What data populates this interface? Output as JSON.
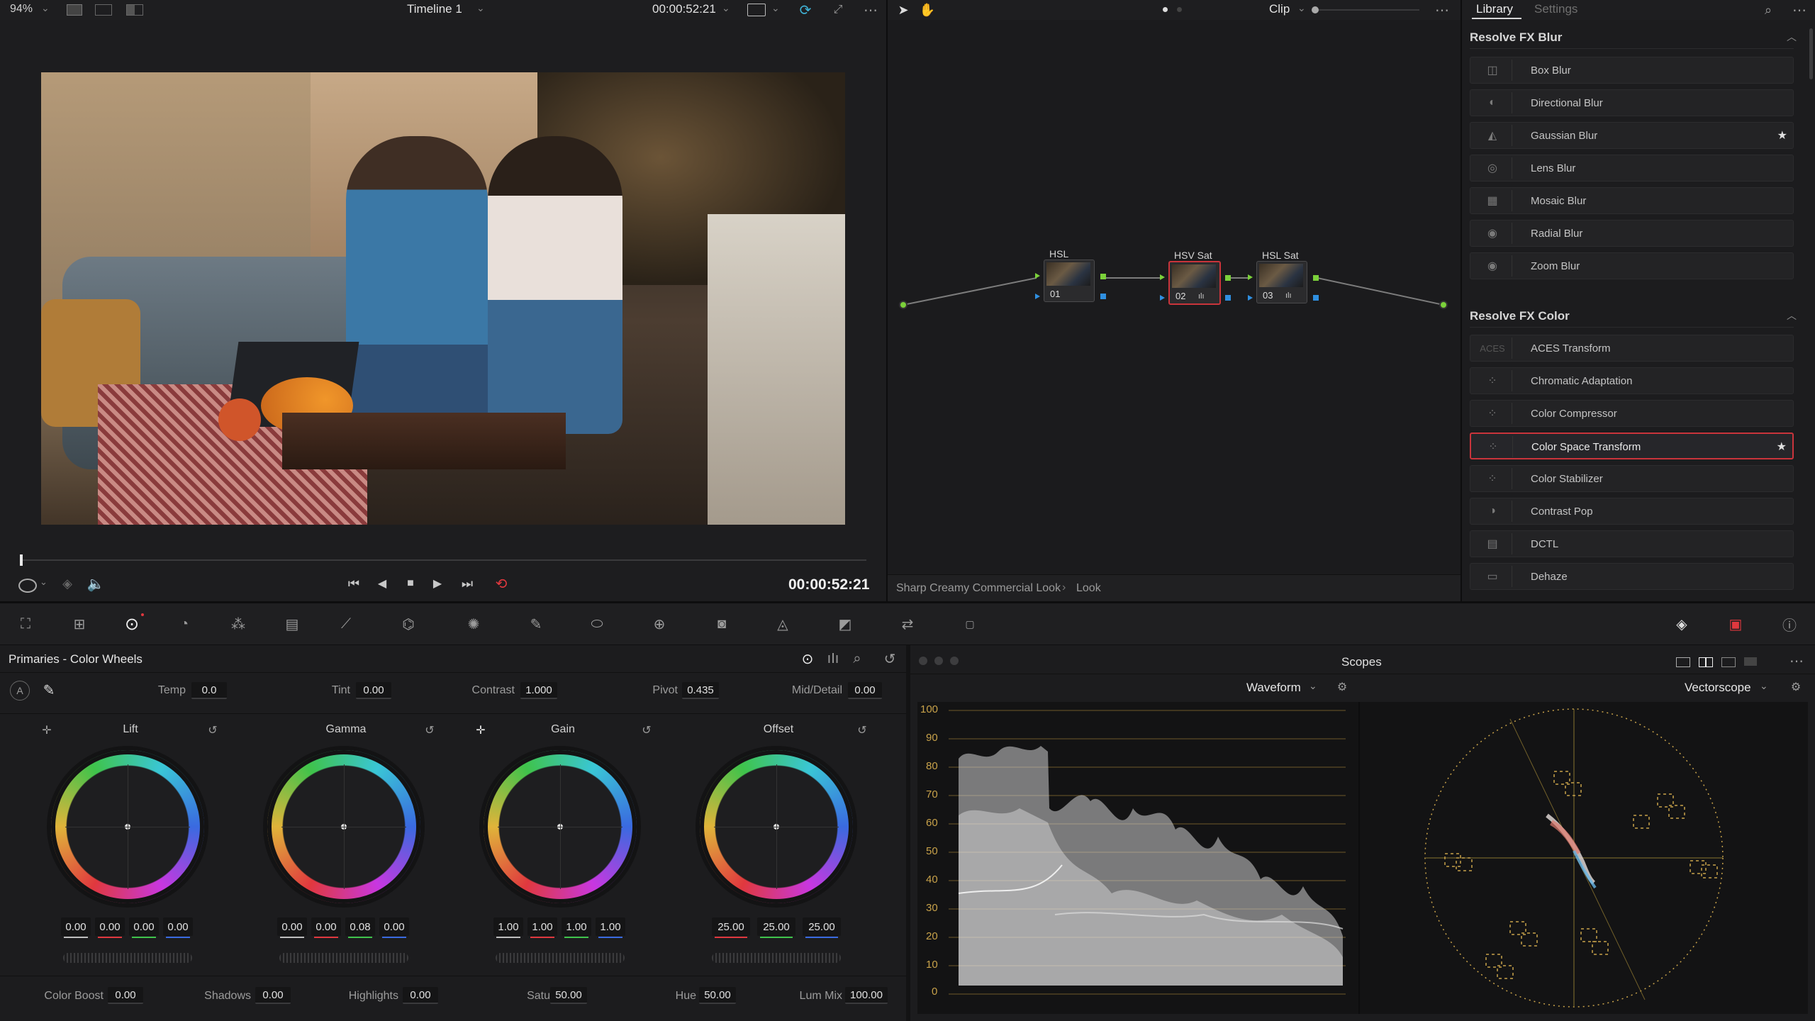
{
  "viewer": {
    "zoom": "94%",
    "timeline_name": "Timeline 1",
    "timecode_top": "00:00:52:21",
    "timecode_bottom": "00:00:52:21",
    "playhead_fraction": 0.0
  },
  "node_editor": {
    "mode": "Clip",
    "nodes": [
      {
        "label": "HSL",
        "number": "01"
      },
      {
        "label": "HSV Sat",
        "number": "02"
      },
      {
        "label": "HSL Sat",
        "number": "03"
      }
    ],
    "breadcrumb": [
      "Sharp Creamy Commercial Look",
      "Look"
    ]
  },
  "library": {
    "tabs": [
      "Library",
      "Settings"
    ],
    "groups": [
      {
        "title": "Resolve FX Blur",
        "items": [
          {
            "label": "Box Blur",
            "starred": false
          },
          {
            "label": "Directional Blur",
            "starred": false
          },
          {
            "label": "Gaussian Blur",
            "starred": true
          },
          {
            "label": "Lens Blur",
            "starred": false
          },
          {
            "label": "Mosaic Blur",
            "starred": false
          },
          {
            "label": "Radial Blur",
            "starred": false
          },
          {
            "label": "Zoom Blur",
            "starred": false
          }
        ]
      },
      {
        "title": "Resolve FX Color",
        "items": [
          {
            "label": "ACES Transform",
            "starred": false,
            "thumb_text": "ACES"
          },
          {
            "label": "Chromatic Adaptation",
            "starred": false
          },
          {
            "label": "Color Compressor",
            "starred": false
          },
          {
            "label": "Color Space Transform",
            "starred": true,
            "selected": true
          },
          {
            "label": "Color Stabilizer",
            "starred": false
          },
          {
            "label": "Contrast Pop",
            "starred": false
          },
          {
            "label": "DCTL",
            "starred": false
          },
          {
            "label": "Dehaze",
            "starred": false
          }
        ]
      }
    ]
  },
  "primaries": {
    "title": "Primaries - Color Wheels",
    "temp_label": "Temp",
    "temp": "0.0",
    "tint_label": "Tint",
    "tint": "0.00",
    "contrast_label": "Contrast",
    "contrast": "1.000",
    "pivot_label": "Pivot",
    "pivot": "0.435",
    "mid_detail_label": "Mid/Detail",
    "mid_detail": "0.00",
    "wheels": [
      {
        "name": "Lift",
        "values": [
          "0.00",
          "0.00",
          "0.00",
          "0.00"
        ]
      },
      {
        "name": "Gamma",
        "values": [
          "0.00",
          "0.00",
          "0.08",
          "0.00"
        ]
      },
      {
        "name": "Gain",
        "values": [
          "1.00",
          "1.00",
          "1.00",
          "1.00"
        ]
      },
      {
        "name": "Offset",
        "values": [
          "25.00",
          "25.00",
          "25.00"
        ]
      }
    ],
    "color_boost_label": "Color Boost",
    "color_boost": "0.00",
    "shadows_label": "Shadows",
    "shadows": "0.00",
    "highlights_label": "Highlights",
    "highlights": "0.00",
    "saturation_label": "Saturation",
    "saturation": "50.00",
    "hue_label": "Hue",
    "hue": "50.00",
    "lum_mix_label": "Lum Mix",
    "lum_mix": "100.00"
  },
  "scopes": {
    "title": "Scopes",
    "left_scope": "Waveform",
    "right_scope": "Vectorscope",
    "waveform_ticks": [
      "100",
      "90",
      "80",
      "70",
      "60",
      "50",
      "40",
      "30",
      "20",
      "10",
      "0"
    ]
  },
  "colors": {
    "accent_red": "#c9343b",
    "node_green": "#7bd13a",
    "node_blue": "#2f8fe0",
    "scope_grid": "#b88a2a"
  }
}
